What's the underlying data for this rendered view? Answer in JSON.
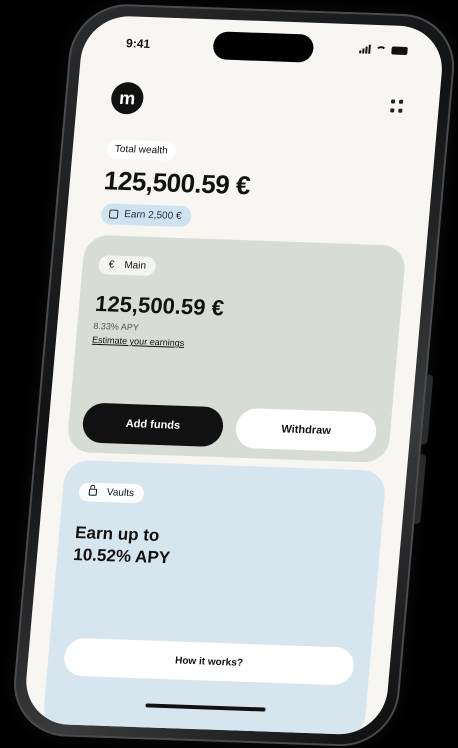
{
  "status_bar": {
    "time": "9:41"
  },
  "header": {
    "logo_letter": "m"
  },
  "wealth": {
    "label": "Total wealth",
    "value": "125,500.59 €",
    "earn_badge": "Earn 2,500 €"
  },
  "main_account": {
    "currency_symbol": "€",
    "name": "Main",
    "balance": "125,500.59 €",
    "apy": "8.33% APY",
    "estimate_link": "Estimate your earnings",
    "add_funds_label": "Add funds",
    "withdraw_label": "Withdraw"
  },
  "vaults": {
    "name": "Vaults",
    "title_line1": "Earn up to",
    "title_line2": "10.52% APY",
    "how_label": "How it works?"
  },
  "colors": {
    "background": "#000000",
    "screen": "#f7f6f3",
    "main_card": "#d7ddd5",
    "vault_card": "#d7e6ee",
    "earn_badge": "#cfe3ef"
  }
}
